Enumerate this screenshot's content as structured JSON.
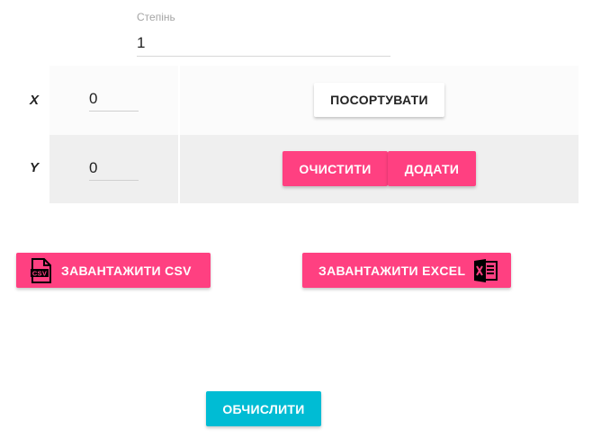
{
  "degree": {
    "label": "Степінь",
    "value": "1"
  },
  "table": {
    "x_label": "X",
    "y_label": "Y",
    "x_value": "0",
    "y_value": "0"
  },
  "buttons": {
    "sort": "ПОСОРТУВАТИ",
    "clear": "ОЧИСТИТИ",
    "add": "ДОДАТИ",
    "upload_csv": "ЗАВАНТАЖИТИ CSV",
    "upload_excel": "ЗАВАНТАЖИТИ EXCEL",
    "calculate": "ОБЧИСЛИТИ"
  },
  "icons": {
    "csv": "csv-file-icon",
    "excel": "excel-file-icon"
  },
  "colors": {
    "accent_pink": "#ff4081",
    "accent_cyan": "#00bcd4",
    "row_x_bg": "#fbfbfb",
    "row_y_bg": "#efefef"
  }
}
